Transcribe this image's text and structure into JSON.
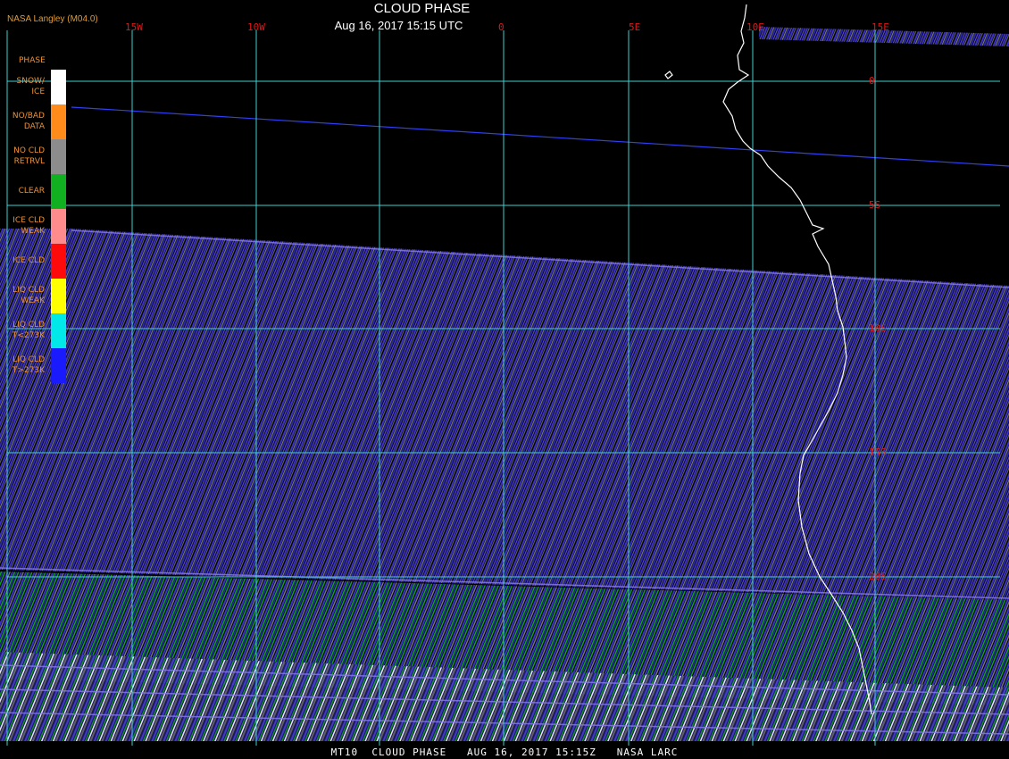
{
  "header": {
    "organization": "NASA Langley (M04.0)",
    "title": "CLOUD PHASE",
    "subtitle": "Aug 16, 2017 15:15 UTC"
  },
  "footer": {
    "text": "MT10  CLOUD PHASE   AUG 16, 2017 15:15Z   NASA LARC"
  },
  "legend": {
    "title": "PHASE",
    "items": [
      {
        "label": "SNOW/\nICE",
        "color": "#ffffff"
      },
      {
        "label": "NO/BAD\nDATA",
        "color": "#ff8c1a"
      },
      {
        "label": "NO CLD\nRETRVL",
        "color": "#8c8c8c"
      },
      {
        "label": "CLEAR",
        "color": "#10b020"
      },
      {
        "label": "ICE CLD\nWEAK",
        "color": "#ff8c8c"
      },
      {
        "label": "ICE CLD",
        "color": "#ff0a0a"
      },
      {
        "label": "LIQ CLD\nWEAK",
        "color": "#ffff00"
      },
      {
        "label": "LIQ CLD\nT<273K",
        "color": "#00e8e8"
      },
      {
        "label": "LIQ CLD\nT>273K",
        "color": "#1a1aff"
      }
    ]
  },
  "grid": {
    "longitudes": [
      "15W",
      "10W",
      "0",
      "5E",
      "10E",
      "15E"
    ],
    "latitudes": [
      "0",
      "5S",
      "10S",
      "15S",
      "20S"
    ],
    "line_color": "#3fd0d0",
    "label_color": "#e01818"
  },
  "map": {
    "coastline_color": "#ffffff",
    "swath_colors": [
      "#3a32c8",
      "#7a7a7a",
      "#10a020",
      "#ffffff",
      "#ff8c1a"
    ]
  }
}
